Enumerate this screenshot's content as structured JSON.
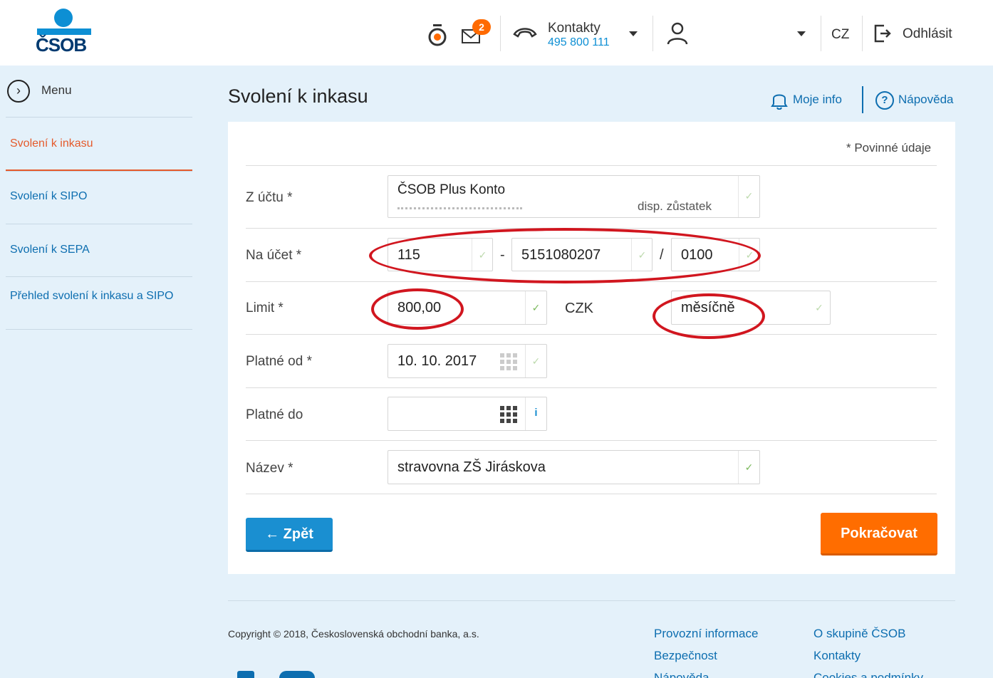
{
  "brand": {
    "logo_text": "ČSOB"
  },
  "header": {
    "notification_count": "2",
    "contacts_label": "Kontakty",
    "contacts_phone": "495 800 111",
    "language": "CZ",
    "logout_label": "Odhlásit"
  },
  "sidebar": {
    "menu_label": "Menu",
    "items": [
      {
        "label": "Svolení k inkasu",
        "active": true
      },
      {
        "label": "Svolení k SIPO"
      },
      {
        "label": "Svolení k SEPA"
      },
      {
        "label": "Přehled svolení k inkasu a SIPO"
      }
    ]
  },
  "main": {
    "title": "Svolení k inkasu",
    "moje_info": "Moje info",
    "help": "Nápověda",
    "required_note": "* Povinné údaje"
  },
  "form": {
    "from_account": {
      "label": "Z účtu *",
      "value": "ČSOB Plus Konto",
      "balance_label": "disp. zůstatek"
    },
    "to_account": {
      "label": "Na účet *",
      "prefix": "115",
      "number": "5151080207",
      "bank_code": "0100",
      "dash": "-",
      "slash": "/"
    },
    "limit": {
      "label": "Limit *",
      "amount": "800,00",
      "currency": "CZK",
      "period": "měsíčně"
    },
    "valid_from": {
      "label": "Platné od *",
      "value": "10. 10. 2017"
    },
    "valid_to": {
      "label": "Platné do",
      "value": "",
      "info_icon": "i"
    },
    "name": {
      "label": "Název *",
      "value": "stravovna ZŠ Jiráskova"
    }
  },
  "buttons": {
    "back": "← Zpět",
    "continue": "Pokračovat"
  },
  "footer": {
    "copyright": "Copyright © 2018, Československá obchodní banka, a.s.",
    "links_col1": [
      "Provozní informace",
      "Bezpečnost",
      "Nápověda"
    ],
    "links_col2": [
      "O skupině ČSOB",
      "Kontakty",
      "Cookies a podmínky"
    ]
  },
  "colors": {
    "accent_blue": "#0d6eb0",
    "orange": "#ff6d00",
    "annotation_red": "#d1161f",
    "active_item": "#e55a2b"
  }
}
